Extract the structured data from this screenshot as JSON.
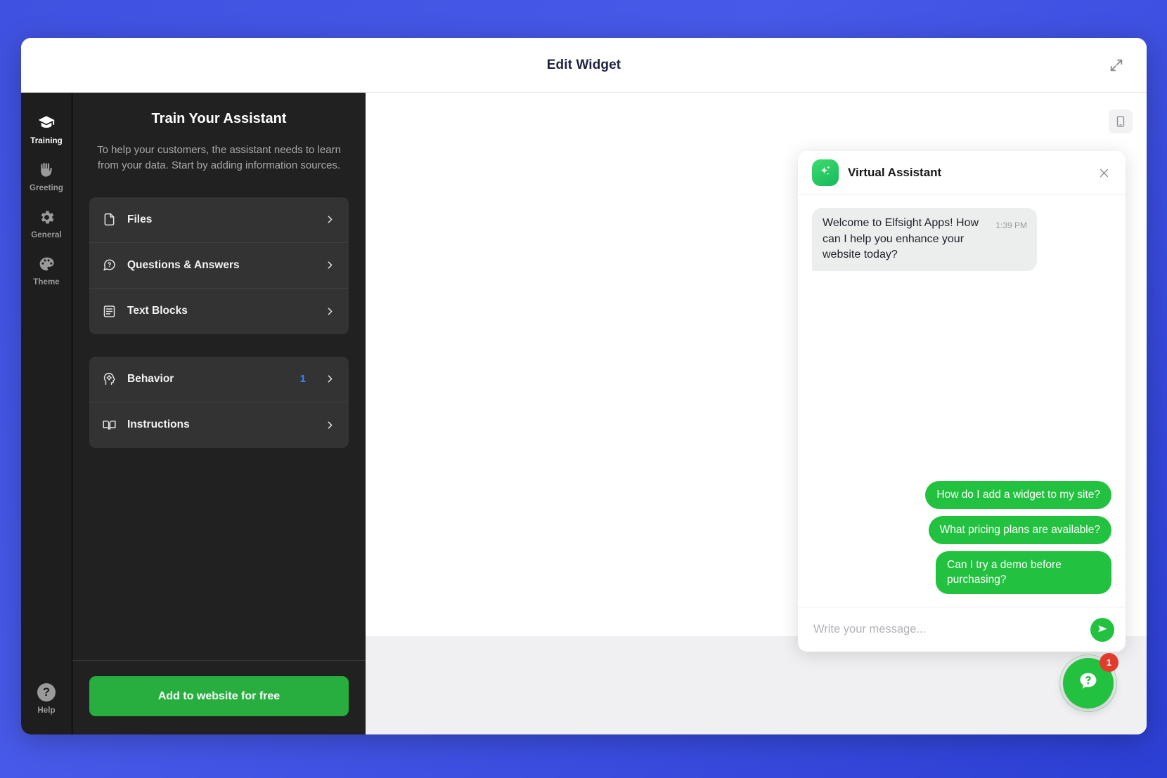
{
  "header": {
    "title": "Edit Widget",
    "expand_icon": "expand-arrows-icon"
  },
  "rail": {
    "items": [
      {
        "label": "Training",
        "icon": "graduation-cap-icon",
        "active": true
      },
      {
        "label": "Greeting",
        "icon": "waving-hand-icon",
        "active": false
      },
      {
        "label": "General",
        "icon": "gear-icon",
        "active": false
      },
      {
        "label": "Theme",
        "icon": "palette-icon",
        "active": false
      }
    ],
    "help": {
      "label": "Help",
      "icon": "question-circle-icon"
    }
  },
  "panel": {
    "title": "Train Your Assistant",
    "description": "To help your customers, the assistant needs to learn from your data. Start by adding information sources.",
    "groups": [
      {
        "rows": [
          {
            "label": "Files",
            "icon": "file-icon",
            "badge": ""
          },
          {
            "label": "Questions & Answers",
            "icon": "question-chat-icon",
            "badge": ""
          },
          {
            "label": "Text Blocks",
            "icon": "text-block-icon",
            "badge": ""
          }
        ]
      },
      {
        "rows": [
          {
            "label": "Behavior",
            "icon": "head-gear-icon",
            "badge": "1"
          },
          {
            "label": "Instructions",
            "icon": "open-book-icon",
            "badge": ""
          }
        ]
      }
    ],
    "cta_label": "Add to website for free"
  },
  "preview": {
    "device_toggle_icon": "mobile-phone-icon",
    "chat": {
      "assistant_name": "Virtual Assistant",
      "avatar_icon": "sparkle-icon",
      "close_icon": "close-icon",
      "bot_message": "Welcome to Elfsight Apps! How can I help you enhance your website today?",
      "bot_message_time": "1:39 PM",
      "suggestions": [
        "How do I add a widget to my site?",
        "What pricing plans are available?",
        "Can I try a demo before purchasing?"
      ],
      "input_placeholder": "Write your message...",
      "send_icon": "send-paper-plane-icon"
    },
    "launcher": {
      "icon": "question-speech-bubble-icon",
      "badge": "1"
    }
  },
  "colors": {
    "backdrop_blue": "#3f51e0",
    "accent_green": "#22c13f",
    "cta_green": "#27ae3f",
    "badge_blue": "#3b82f6",
    "badge_red": "#e23b2e",
    "panel_dark": "#212121",
    "rail_dark": "#1e1e1e",
    "row_dark": "#333333"
  }
}
